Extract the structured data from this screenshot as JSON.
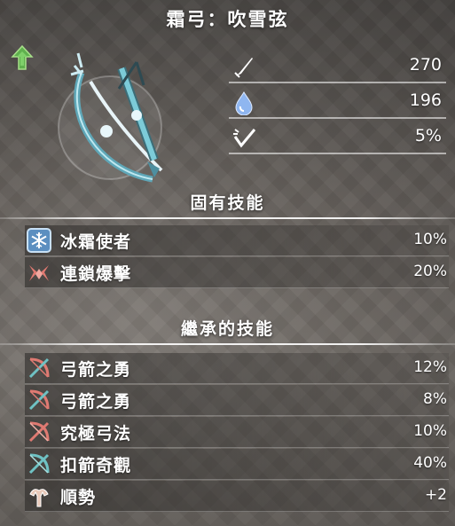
{
  "weapon": {
    "name": "霜弓：吹雪弦",
    "icon": "frost-bow-image",
    "rank_icon": "green-arrow-up-icon"
  },
  "stats": [
    {
      "icon": "blade-attack-icon",
      "value": "270"
    },
    {
      "icon": "water-drop-element-icon",
      "value": "196"
    },
    {
      "icon": "affinity-icon",
      "value": "5%"
    }
  ],
  "inherent_skills": {
    "title": "固有技能",
    "items": [
      {
        "icon": "snowflake-icon",
        "name": "冰霜使者",
        "level": "10%"
      },
      {
        "icon": "chain-burst-icon",
        "name": "連鎖爆擊",
        "level": "20%"
      }
    ]
  },
  "inherited_skills": {
    "title": "繼承的技能",
    "items": [
      {
        "icon": "crossed-bow-icon",
        "name": "弓箭之勇",
        "level": "12%"
      },
      {
        "icon": "crossed-bow-icon",
        "name": "弓箭之勇",
        "level": "8%"
      },
      {
        "icon": "crossed-bow-icon",
        "name": "究極弓法",
        "level": "10%"
      },
      {
        "icon": "crossed-bow-icon",
        "name": "扣箭奇觀",
        "level": "40%"
      },
      {
        "icon": "flex-muscle-icon",
        "name": "順勢",
        "level": "+2"
      }
    ]
  },
  "colors": {
    "text": "#ffffff",
    "water_blue": "#8fb6f0",
    "skill_icon_red": "#e07a72",
    "skill_icon_teal": "#6fc2c4",
    "rank_green": "#6dc25a",
    "frost_blue": "#9fd8e6"
  }
}
